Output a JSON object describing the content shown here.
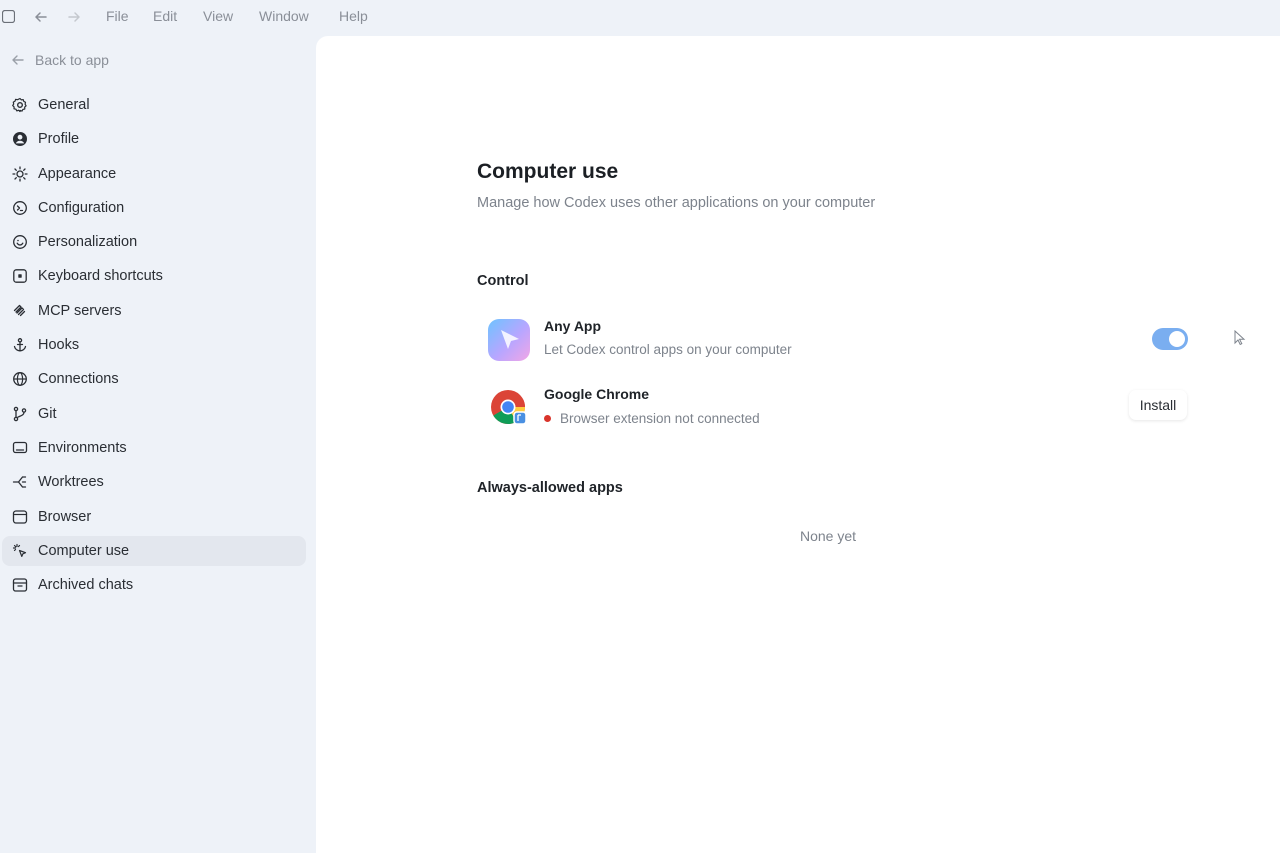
{
  "menubar": {
    "items": [
      "File",
      "Edit",
      "View",
      "Window",
      "Help"
    ]
  },
  "sidebar": {
    "back_label": "Back to app",
    "items": [
      {
        "label": "General",
        "icon": "gear-icon"
      },
      {
        "label": "Profile",
        "icon": "user-icon"
      },
      {
        "label": "Appearance",
        "icon": "sun-icon"
      },
      {
        "label": "Configuration",
        "icon": "config-icon"
      },
      {
        "label": "Personalization",
        "icon": "smile-icon"
      },
      {
        "label": "Keyboard shortcuts",
        "icon": "keyboard-icon"
      },
      {
        "label": "MCP servers",
        "icon": "mcp-icon"
      },
      {
        "label": "Hooks",
        "icon": "anchor-icon"
      },
      {
        "label": "Connections",
        "icon": "globe-icon"
      },
      {
        "label": "Git",
        "icon": "git-branch-icon"
      },
      {
        "label": "Environments",
        "icon": "monitor-icon"
      },
      {
        "label": "Worktrees",
        "icon": "worktree-icon"
      },
      {
        "label": "Browser",
        "icon": "browser-icon"
      },
      {
        "label": "Computer use",
        "icon": "cursor-click-icon",
        "active": true
      },
      {
        "label": "Archived chats",
        "icon": "archive-icon"
      }
    ]
  },
  "main": {
    "title": "Computer use",
    "subtitle": "Manage how Codex uses other applications on your computer",
    "control_section": {
      "title": "Control",
      "apps": [
        {
          "name": "Any App",
          "description": "Let Codex control apps on your computer",
          "enabled": true
        },
        {
          "name": "Google Chrome",
          "description": "Browser extension not connected",
          "status_color": "#d9342b",
          "action_label": "Install"
        }
      ]
    },
    "allowed_section": {
      "title": "Always-allowed apps",
      "empty_text": "None yet"
    }
  },
  "colors": {
    "sidebar_bg": "#eef2f8",
    "panel_bg": "#ffffff",
    "toggle_on": "#7aaef0",
    "status_error": "#d9342b"
  }
}
